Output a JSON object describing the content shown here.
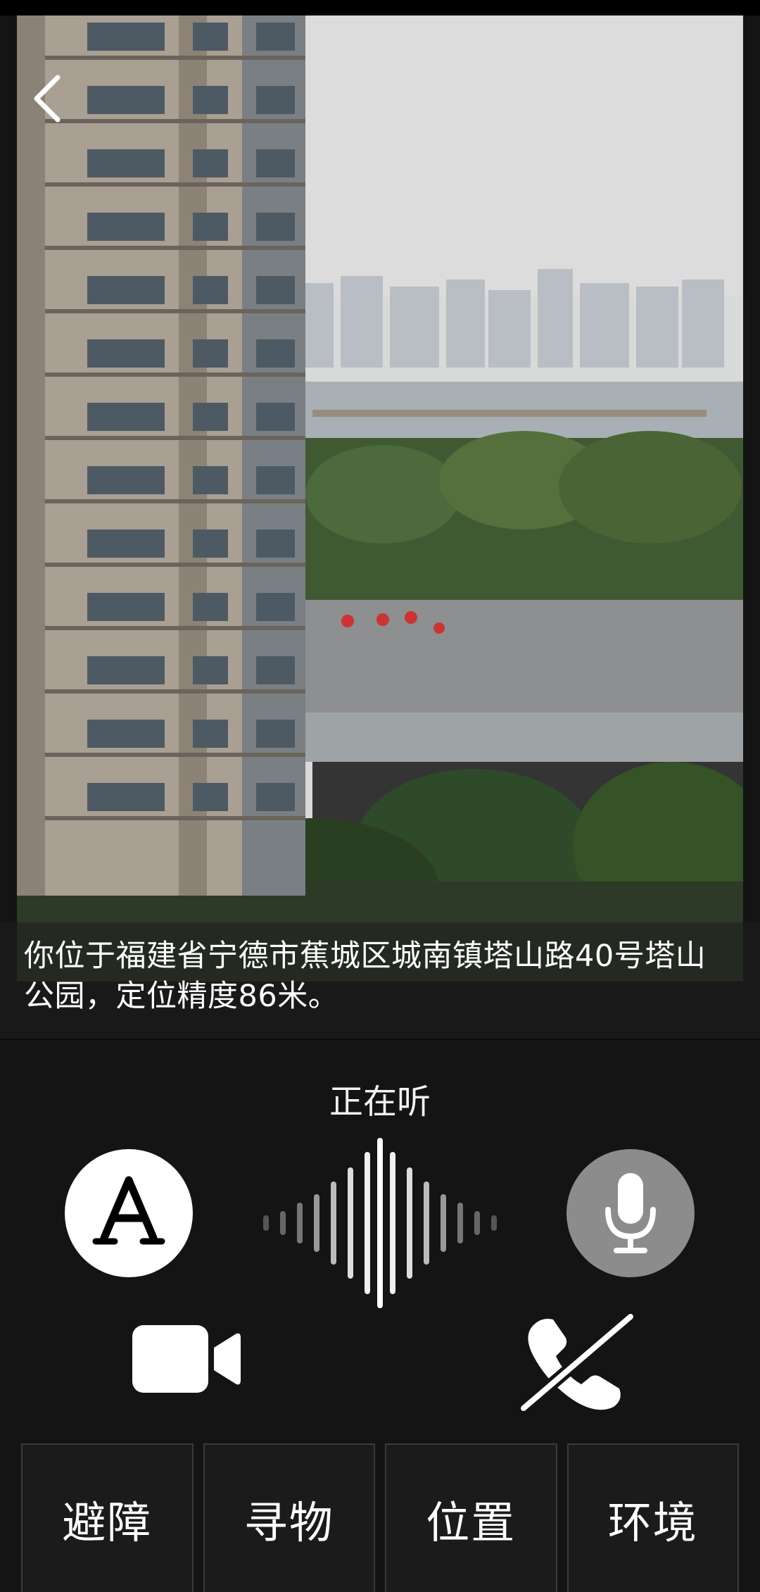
{
  "header": {
    "back_icon": "chevron-left-icon"
  },
  "location": {
    "text": "你位于福建省宁德市蕉城区城南镇塔山路40号塔山公园，定位精度86米。"
  },
  "listening": {
    "status": "正在听"
  },
  "controls": {
    "text_icon": "letter-a-icon",
    "mic_icon": "microphone-icon",
    "video_icon": "video-camera-icon",
    "hangup_icon": "phone-off-icon",
    "wave_icon": "sound-wave-icon"
  },
  "tabs": [
    {
      "label": "避障"
    },
    {
      "label": "寻物"
    },
    {
      "label": "位置"
    },
    {
      "label": "环境"
    }
  ],
  "colors": {
    "background": "#141414",
    "mic_button": "#8c8c8c",
    "text_button": "#ffffff"
  }
}
